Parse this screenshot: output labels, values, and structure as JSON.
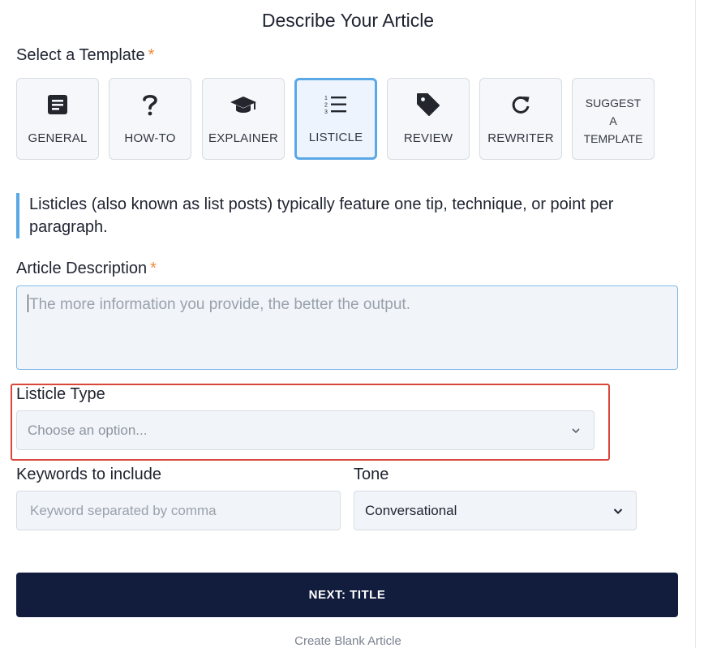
{
  "page_title": "Describe Your Article",
  "template_section": {
    "label": "Select a Template",
    "required_mark": "*",
    "templates": [
      {
        "label": "GENERAL",
        "icon": "document-icon"
      },
      {
        "label": "HOW-TO",
        "icon": "question-icon"
      },
      {
        "label": "EXPLAINER",
        "icon": "graduation-cap-icon"
      },
      {
        "label": "LISTICLE",
        "icon": "numbered-list-icon",
        "selected": true
      },
      {
        "label": "REVIEW",
        "icon": "tag-icon"
      },
      {
        "label": "REWRITER",
        "icon": "refresh-icon"
      },
      {
        "label_lines": [
          "SUGGEST",
          "A",
          "TEMPLATE"
        ]
      }
    ]
  },
  "template_note": "Listicles (also known as list posts) typically feature one tip, technique, or point per paragraph.",
  "article_description": {
    "label": "Article Description",
    "required_mark": "*",
    "placeholder": "The more information you provide, the better the output."
  },
  "listicle_type": {
    "label": "Listicle Type",
    "placeholder": "Choose an option..."
  },
  "keywords": {
    "label": "Keywords to include",
    "placeholder": "Keyword separated by comma"
  },
  "tone": {
    "label": "Tone",
    "value": "Conversational"
  },
  "next_button": "NEXT: TITLE",
  "create_blank": "Create Blank Article",
  "colors": {
    "accent": "#5aa9e6",
    "primary_button": "#121c3d",
    "required": "#f08a3a",
    "highlight_box": "#d8463c"
  }
}
